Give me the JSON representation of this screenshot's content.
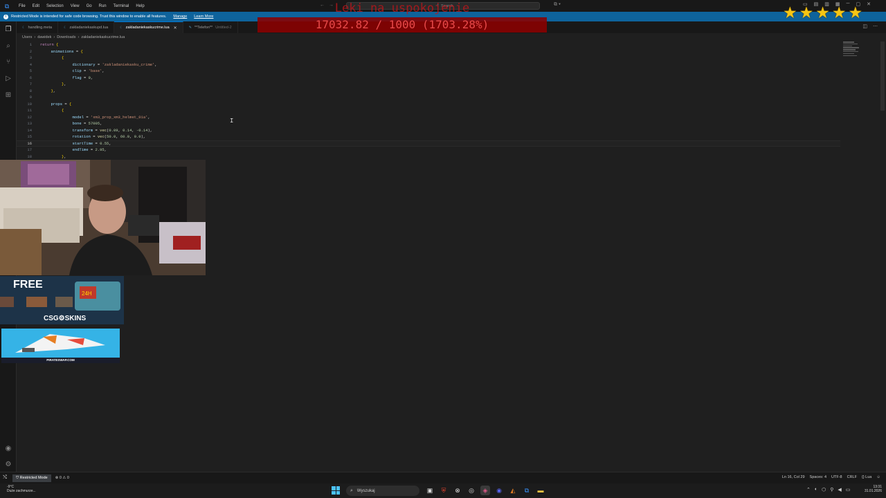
{
  "titlebar": {
    "menu": [
      "File",
      "Edit",
      "Selection",
      "View",
      "Go",
      "Run",
      "Terminal",
      "Help"
    ],
    "command_center": "Search"
  },
  "banner": {
    "text": "Restricted Mode is intended for safe code browsing. Trust this window to enable all features.",
    "manage": "Manage",
    "learn_more": "Learn More"
  },
  "tabs": [
    {
      "label": "handling.meta",
      "active": false
    },
    {
      "label": "zakladaniekaskupd.lua",
      "active": false
    },
    {
      "label": "zakladaniekaskucrime.lua",
      "active": true
    },
    {
      "label": "**Telefon**",
      "sub": "Untitled-2",
      "active": false
    }
  ],
  "breadcrumb": [
    "Users",
    "dawidek",
    "Downloads",
    "zakladaniekaskucrime.lua"
  ],
  "editor": {
    "current_line": 16,
    "lines": [
      {
        "n": "1",
        "indent": 0,
        "html": "<span class='kw'>return</span> <span class='brace'>{</span>"
      },
      {
        "n": "2",
        "indent": 1,
        "html": "animations <span class='punc'>=</span> <span class='brace'>{</span>"
      },
      {
        "n": "3",
        "indent": 2,
        "html": "<span class='brace'>{</span>"
      },
      {
        "n": "4",
        "indent": 3,
        "html": "dictionary <span class='punc'>=</span> <span class='str'>'zakladaniekasku_crime'</span><span class='punc'>,</span>"
      },
      {
        "n": "5",
        "indent": 3,
        "html": "clip <span class='punc'>=</span> <span class='str'>'base'</span><span class='punc'>,</span>"
      },
      {
        "n": "6",
        "indent": 3,
        "html": "flag <span class='punc'>=</span> <span class='num'>0</span><span class='punc'>,</span>"
      },
      {
        "n": "7",
        "indent": 2,
        "html": "<span class='brace'>}</span><span class='punc'>,</span>"
      },
      {
        "n": "8",
        "indent": 1,
        "html": "<span class='brace'>}</span><span class='punc'>,</span>"
      },
      {
        "n": "9",
        "indent": 0,
        "html": ""
      },
      {
        "n": "10",
        "indent": 1,
        "html": "props <span class='punc'>=</span> <span class='brace'>{</span>"
      },
      {
        "n": "11",
        "indent": 2,
        "html": "<span class='brace'>{</span>"
      },
      {
        "n": "12",
        "indent": 3,
        "html": "model <span class='punc'>=</span> <span class='str'>'xm3_prop_xm3_helmet_01a'</span><span class='punc'>,</span>"
      },
      {
        "n": "13",
        "indent": 3,
        "html": "bone <span class='punc'>=</span> <span class='num'>57005</span><span class='punc'>,</span>"
      },
      {
        "n": "14",
        "indent": 3,
        "html": "transform <span class='punc'>=</span> <span class='fn'>vec</span><span class='punc'>(</span><span class='num'>0.09</span><span class='punc'>, </span><span class='num'>0.14</span><span class='punc'>, </span><span class='num'>-0.14</span><span class='punc'>),</span>"
      },
      {
        "n": "15",
        "indent": 3,
        "html": "rotation <span class='punc'>=</span> <span class='fn'>vec</span><span class='punc'>(</span><span class='num'>50.0</span><span class='punc'>, </span><span class='num'>60.0</span><span class='punc'>, </span><span class='num'>0.0</span><span class='punc'>),</span>"
      },
      {
        "n": "16",
        "indent": 3,
        "html": "startTime <span class='punc'>=</span> <span class='num'>0.55</span><span class='punc'>,</span>"
      },
      {
        "n": "17",
        "indent": 3,
        "html": "endTime <span class='punc'>=</span> <span class='num'>2.95</span><span class='punc'>,</span>"
      },
      {
        "n": "18",
        "indent": 2,
        "html": "<span class='brace'>}</span><span class='punc'>,</span>"
      }
    ]
  },
  "overlay": {
    "title": "Leki na uspokojenie",
    "value": "17032.82 / 1000 (1703.28%)",
    "stars": 5,
    "star_color": "#f6c514"
  },
  "ads": {
    "free": "FREE",
    "brand": "CSG⚙SKINS",
    "pirateswap": "PIRATESWAP.COM"
  },
  "statusbar": {
    "restricted": "Restricted Mode",
    "problems": "⊗ 0 ⚠ 0",
    "right": [
      "Ln 16, Col 29",
      "Spaces: 4",
      "UTF-8",
      "CRLF",
      "{} Lua",
      "☺"
    ]
  },
  "taskbar": {
    "temp": "-9°C",
    "weather": "Duże zachmurze...",
    "search": "Wyszukaj",
    "time": "13:31",
    "date": "31.01.2026"
  }
}
